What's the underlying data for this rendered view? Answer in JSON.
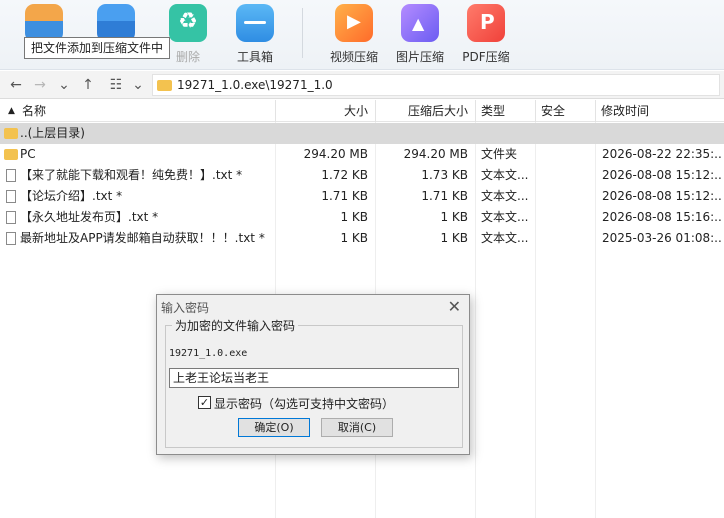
{
  "toolbar": {
    "items": [
      {
        "label": "",
        "icon": "add-archive-icon"
      },
      {
        "label": "",
        "icon": "extract-icon"
      },
      {
        "label": "删除",
        "icon": "recycle-icon"
      },
      {
        "label": "工具箱",
        "icon": "toolbox-icon"
      },
      {
        "label": "视频压缩",
        "icon": "video-compress-icon"
      },
      {
        "label": "图片压缩",
        "icon": "image-compress-icon"
      },
      {
        "label": "PDF压缩",
        "icon": "pdf-compress-icon"
      }
    ],
    "tooltip": "把文件添加到压缩文件中"
  },
  "address": {
    "path": "19271_1.0.exe\\19271_1.0"
  },
  "columns": {
    "name": "名称",
    "size": "大小",
    "packed": "压缩后大小",
    "type": "类型",
    "security": "安全",
    "modified": "修改时间"
  },
  "rows": [
    {
      "name": "..(上层目录)",
      "size": "",
      "packed": "",
      "type": "",
      "security": "",
      "modified": ""
    },
    {
      "name": "PC",
      "size": "294.20 MB",
      "packed": "294.20 MB",
      "type": "文件夹",
      "security": "",
      "modified": "2026-08-22 22:35:..."
    },
    {
      "name": "【来了就能下载和观看！纯免费！】.txt *",
      "size": "1.72 KB",
      "packed": "1.73 KB",
      "type": "文本文...",
      "security": "",
      "modified": "2026-08-08 15:12:..."
    },
    {
      "name": "【论坛介绍】.txt *",
      "size": "1.71 KB",
      "packed": "1.71 KB",
      "type": "文本文...",
      "security": "",
      "modified": "2026-08-08 15:12:..."
    },
    {
      "name": "【永久地址发布页】.txt *",
      "size": "1 KB",
      "packed": "1 KB",
      "type": "文本文...",
      "security": "",
      "modified": "2026-08-08 15:16:..."
    },
    {
      "name": "最新地址及APP请发邮箱自动获取！！！.txt *",
      "size": "1 KB",
      "packed": "1 KB",
      "type": "文本文...",
      "security": "",
      "modified": "2025-03-26 01:08:..."
    }
  ],
  "dialog": {
    "title": "输入密码",
    "group_label": "为加密的文件输入密码",
    "filename": "19271_1.0.exe",
    "password": "上老王论坛当老王",
    "show_password": true,
    "show_password_label": "显示密码（勾选可支持中文密码）",
    "ok_label": "确定(O)",
    "cancel_label": "取消(C)"
  },
  "colors": {
    "folder": "#f3c24f",
    "selected_row": "#d9d9d9",
    "default_button_border": "#0078d7"
  }
}
